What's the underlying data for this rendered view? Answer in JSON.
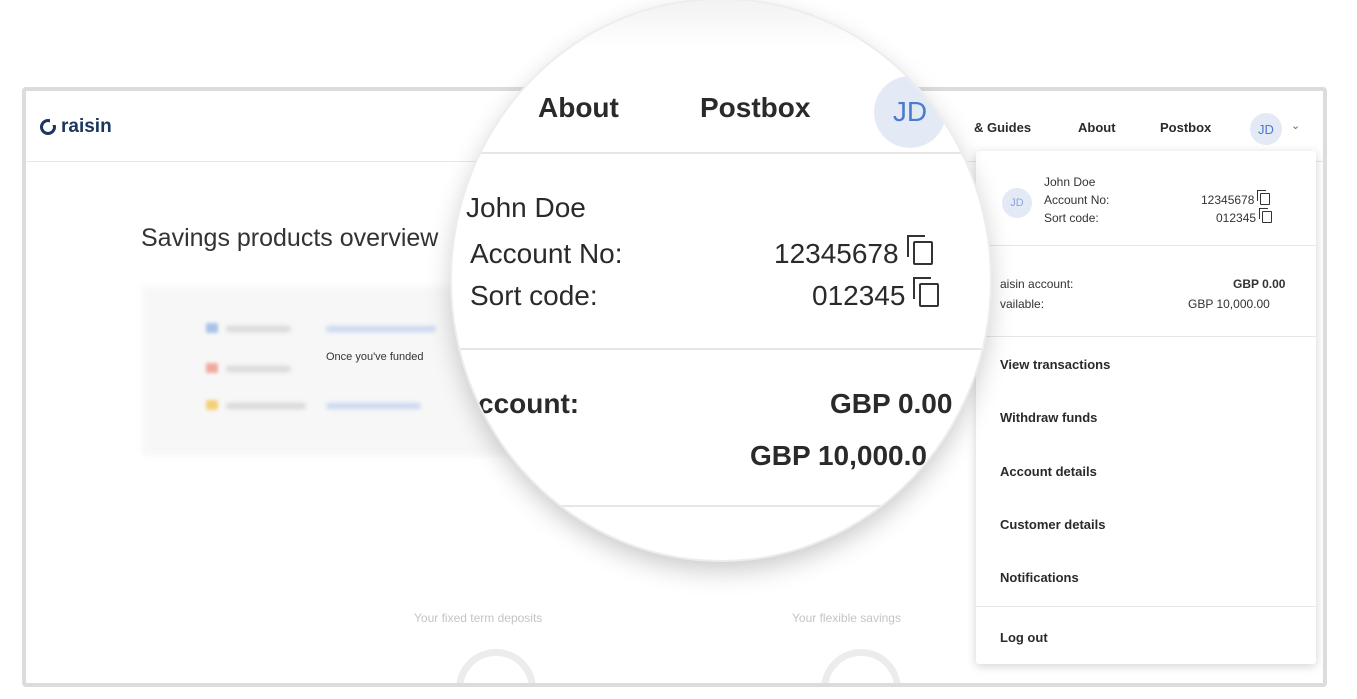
{
  "brand": {
    "name": "raisin"
  },
  "nav": {
    "guides": "& Guides",
    "about": "About",
    "postbox": "Postbox",
    "avatar_initials": "JD"
  },
  "page": {
    "title": "Savings products overview",
    "funded_text": "Once you've funded",
    "fixed_label": "Your fixed term deposits",
    "flexible_label": "Your flexible savings"
  },
  "dropdown": {
    "avatar_initials": "JD",
    "name": "John Doe",
    "account_no_label": "Account No:",
    "account_no": "12345678",
    "sort_code_label": "Sort code:",
    "sort_code": "012345",
    "raisin_account_label": "aisin account:",
    "raisin_account_value": "GBP 0.00",
    "available_label": "vailable:",
    "available_value": "GBP 10,000.00",
    "items": [
      "View transactions",
      "Withdraw funds",
      "Account details",
      "Customer details",
      "Notifications"
    ],
    "logout": "Log out"
  },
  "magnifier": {
    "about": "About",
    "postbox": "Postbox",
    "avatar_initials": "JD",
    "name": "John Doe",
    "account_no_label": "Account No:",
    "account_no": "12345678",
    "sort_code_label": "Sort code:",
    "sort_code": "012345",
    "account_label": "ccount:",
    "account_value": "GBP 0.00",
    "available_value": "GBP 10,000.0"
  },
  "colors": {
    "brand_navy": "#1b3760",
    "avatar_bg": "#e3eaf6",
    "avatar_fg": "#4a7bd0"
  },
  "icons": [
    "copy-icon",
    "chevron-down-icon",
    "raisin-logo-icon"
  ]
}
